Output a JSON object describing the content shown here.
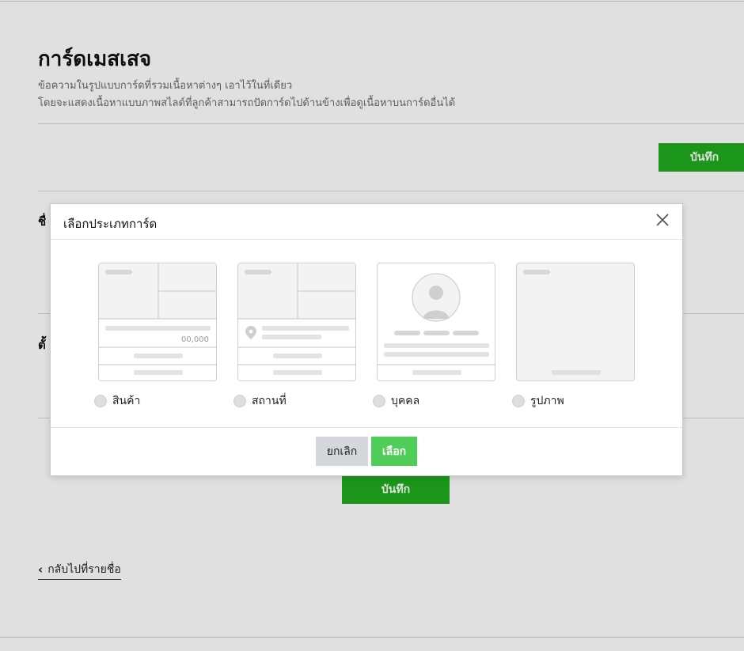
{
  "page": {
    "title": "การ์ดเมสเสจ",
    "desc_line1": "ข้อความในรูปแบบการ์ดที่รวมเนื้อหาต่างๆ เอาไว้ในที่เดียว",
    "desc_line2": "โดยจะแสดงเนื้อหาแบบภาพสไลด์ที่ลูกค้าสามารถปัดการ์ดไปด้านข้างเพื่อดูเนื้อหาบนการ์ดอื่นได้",
    "save_top_label": "บันทึก",
    "field1_label_partial": "ชื่",
    "field2_label_partial": "ตั้",
    "save_bottom_label": "บันทึก",
    "back_link_label": "กลับไปที่รายชื่อ"
  },
  "modal": {
    "title": "เลือกประเภทการ์ด",
    "options": [
      {
        "label": "สินค้า",
        "icon": "product-card-thumb",
        "price_text": "00,000"
      },
      {
        "label": "สถานที่",
        "icon": "location-card-thumb"
      },
      {
        "label": "บุคคล",
        "icon": "person-card-thumb"
      },
      {
        "label": "รูปภาพ",
        "icon": "image-card-thumb"
      }
    ],
    "cancel_label": "ยกเลิก",
    "select_label": "เลือก"
  },
  "colors": {
    "primary_green": "#1fab1f",
    "select_green": "#4fcd59",
    "cancel_gray": "#d4d7dc",
    "placeholder_gray": "#e0e0e0"
  }
}
